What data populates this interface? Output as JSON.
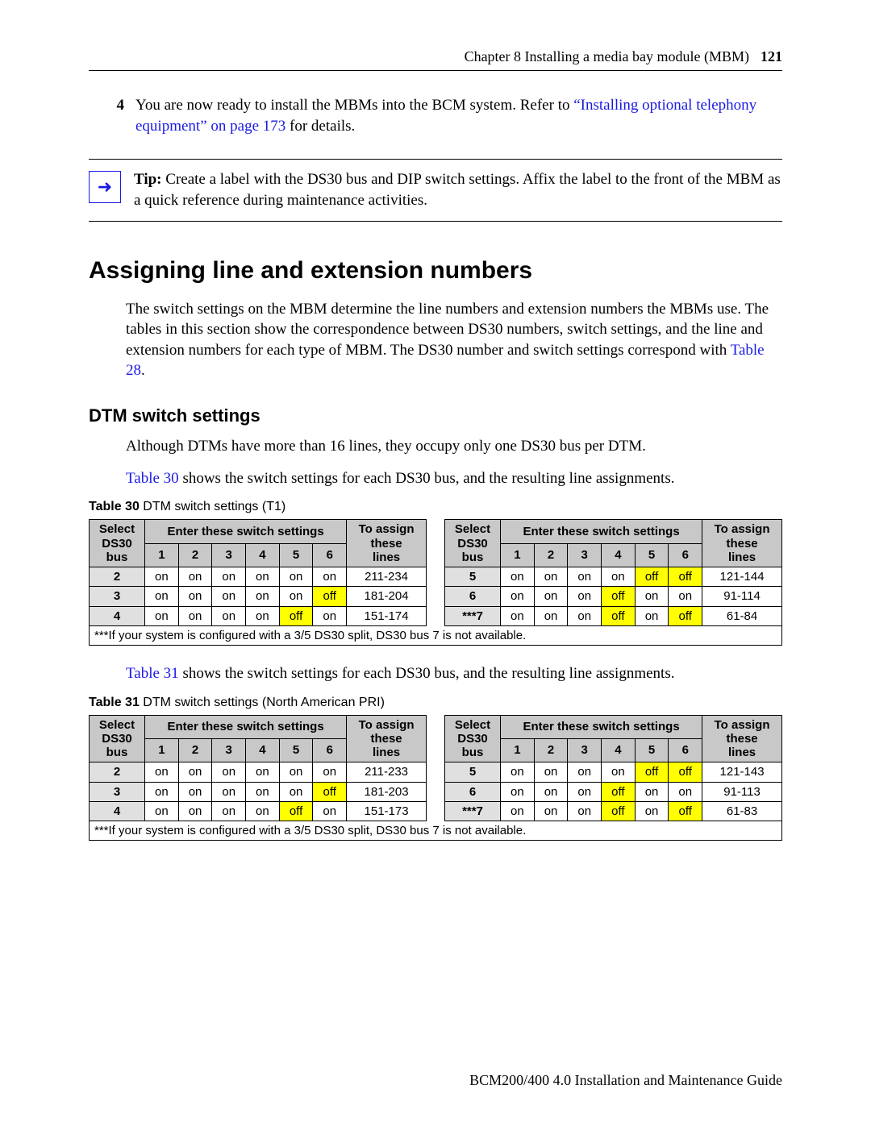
{
  "header": {
    "chapter": "Chapter 8  Installing a media bay module (MBM)",
    "page": "121"
  },
  "step4": {
    "num": "4",
    "pre": "You are now ready to install the MBMs into the BCM system. Refer to ",
    "link": "“Installing optional telephony equipment” on page 173",
    "post": " for details."
  },
  "tip": {
    "label": "Tip:",
    "text": " Create a label with the DS30 bus and DIP switch settings. Affix the label to the front of the MBM as a quick reference during maintenance activities."
  },
  "h1": "Assigning line and extension numbers",
  "p1a": "The switch settings on the MBM determine the line numbers and extension numbers the MBMs use. The tables in this section show the correspondence between DS30 numbers, switch settings, and the line and extension numbers for each type of MBM. The DS30 number and switch settings correspond with ",
  "p1link": "Table 28",
  "p1b": ".",
  "h2": "DTM switch settings",
  "p2": "Although DTMs have more than 16 lines, they occupy only one DS30 bus per DTM.",
  "p3link": "Table 30",
  "p3rest": " shows the switch settings for each DS30 bus, and the resulting line assignments.",
  "cap30_b": "Table 30",
  "cap30_t": "   DTM switch settings (T1)",
  "thSelect": "Select DS30 bus",
  "thEnter": "Enter these switch settings",
  "thAssignA": "To assign these lines",
  "thAssignB": "To assign these lines",
  "cols": [
    "1",
    "2",
    "3",
    "4",
    "5",
    "6"
  ],
  "t30L": [
    {
      "bus": "2",
      "s": [
        "on",
        "on",
        "on",
        "on",
        "on",
        "on"
      ],
      "lines": "211-234"
    },
    {
      "bus": "3",
      "s": [
        "on",
        "on",
        "on",
        "on",
        "on",
        "off"
      ],
      "lines": "181-204"
    },
    {
      "bus": "4",
      "s": [
        "on",
        "on",
        "on",
        "on",
        "off",
        "on"
      ],
      "lines": "151-174"
    }
  ],
  "t30R": [
    {
      "bus": "5",
      "s": [
        "on",
        "on",
        "on",
        "on",
        "off",
        "off"
      ],
      "lines": "121-144"
    },
    {
      "bus": "6",
      "s": [
        "on",
        "on",
        "on",
        "off",
        "on",
        "on"
      ],
      "lines": "91-114"
    },
    {
      "bus": "***7",
      "s": [
        "on",
        "on",
        "on",
        "off",
        "on",
        "off"
      ],
      "lines": "61-84"
    }
  ],
  "footnote30": "***If your system is configured with a 3/5 DS30 split, DS30 bus 7 is not available.",
  "p4link": "Table 31",
  "p4rest": " shows the switch settings for each DS30 bus, and the resulting line assignments.",
  "cap31_b": "Table 31",
  "cap31_t": "   DTM switch settings (North American PRI)",
  "t31L": [
    {
      "bus": "2",
      "s": [
        "on",
        "on",
        "on",
        "on",
        "on",
        "on"
      ],
      "lines": "211-233"
    },
    {
      "bus": "3",
      "s": [
        "on",
        "on",
        "on",
        "on",
        "on",
        "off"
      ],
      "lines": "181-203"
    },
    {
      "bus": "4",
      "s": [
        "on",
        "on",
        "on",
        "on",
        "off",
        "on"
      ],
      "lines": "151-173"
    }
  ],
  "t31R": [
    {
      "bus": "5",
      "s": [
        "on",
        "on",
        "on",
        "on",
        "off",
        "off"
      ],
      "lines": "121-143"
    },
    {
      "bus": "6",
      "s": [
        "on",
        "on",
        "on",
        "off",
        "on",
        "on"
      ],
      "lines": "91-113"
    },
    {
      "bus": "***7",
      "s": [
        "on",
        "on",
        "on",
        "off",
        "on",
        "off"
      ],
      "lines": "61-83"
    }
  ],
  "footnote31": "***If your system is configured with a 3/5 DS30 split, DS30 bus 7 is not available.",
  "footer": "BCM200/400 4.0 Installation and Maintenance Guide"
}
